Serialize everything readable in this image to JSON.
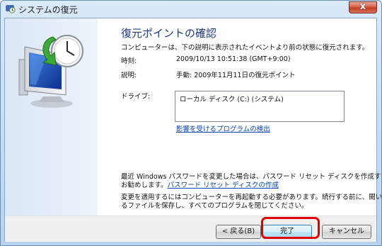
{
  "window": {
    "title": "システムの復元",
    "close_glyph": "x"
  },
  "page": {
    "heading": "復元ポイントの確認",
    "intro": "コンピューターは、下の説明に表示されたイベントより前の状態に復元されます。",
    "time_label": "時刻:",
    "time_value": "2009/10/13 10:51:38 (GMT+9:00)",
    "desc_label": "説明:",
    "desc_value": "手動: 2009年11月11日の復元ポイント",
    "drive_label": "ドライブ:",
    "drive_item": "ローカル ディスク (C:) (システム)",
    "affected_link": "影響を受けるプログラムの検出",
    "password_note_1": "最近 Windows パスワードを変更した場合は、パスワード リセット ディスクを作成することを",
    "password_note_2a": "お勧めします。",
    "password_link": "パスワード リセット ディスクの作成",
    "restart_note_1": "変更を適用するにはコンピューターを再起動する必要があります。続行する前に、開いてい",
    "restart_note_2": "るファイルを保存し、すべてのプログラムを閉じてください。"
  },
  "buttons": {
    "back": "< 戻る(B)",
    "finish": "完了",
    "cancel": "キャンセル"
  },
  "icons": {
    "title": "system-restore-icon",
    "hero": "computer-clock-restore-icon"
  },
  "colors": {
    "heading": "#1e3b86",
    "link": "#0645ad",
    "highlight": "#e00000"
  }
}
